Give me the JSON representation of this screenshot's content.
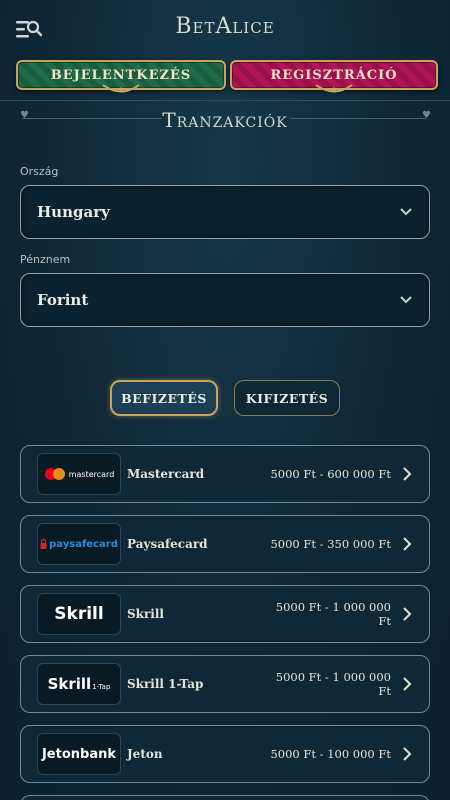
{
  "header": {
    "logo_text": "BetAlice",
    "login_label": "BEJELENTKEZÉS",
    "register_label": "REGISZTRÁCIÓ"
  },
  "page": {
    "title": "Tranzakciók"
  },
  "country": {
    "label": "Ország",
    "value": "Hungary"
  },
  "currency": {
    "label": "Pénznem",
    "value": "Forint"
  },
  "tabs": {
    "deposit": "BEFIZETÉS",
    "withdraw": "KIFIZETÉS",
    "active": "deposit"
  },
  "methods": [
    {
      "name": "Mastercard",
      "range": "5000 Ft - 600 000 Ft",
      "logo_text": "mastercard"
    },
    {
      "name": "Paysafecard",
      "range": "5000 Ft - 350 000 Ft",
      "logo_text": "paysafecard"
    },
    {
      "name": "Skrill",
      "range": "5000 Ft - 1 000 000 Ft",
      "logo_text": "Skrill"
    },
    {
      "name": "Skrill 1-Tap",
      "range": "5000 Ft - 1 000 000 Ft",
      "logo_text": "Skrill",
      "logo_sub": "1-Tap"
    },
    {
      "name": "Jeton",
      "range": "5000 Ft - 100 000 Ft",
      "logo_text": "Jetonbank"
    }
  ],
  "colors": {
    "background": "#0f2a3a",
    "gold": "#c9a35a",
    "login_green": "#1f6b4a",
    "register_pink": "#b01456",
    "mastercard_red": "#eb001b",
    "mastercard_orange": "#f79e1b",
    "paysafe_blue": "#2a8fd6"
  }
}
